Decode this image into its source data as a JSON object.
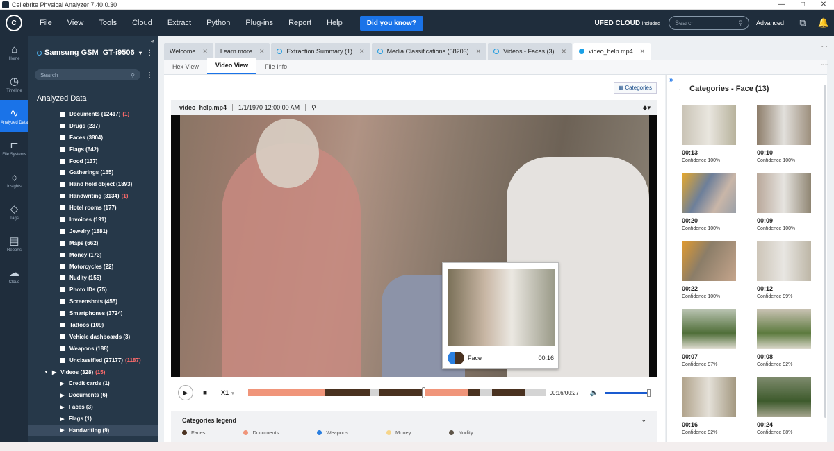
{
  "window": {
    "title": "Cellebrite Physical Analyzer 7.40.0.30",
    "min": "—",
    "max": "□",
    "close": "✕"
  },
  "menu": {
    "items": [
      "File",
      "View",
      "Tools",
      "Cloud",
      "Extract",
      "Python",
      "Plug-ins",
      "Report",
      "Help"
    ],
    "did_you_know": "Did you know?",
    "ufed_cloud": "UFED CLOUD",
    "ufed_included": "included",
    "search_placeholder": "Search",
    "advanced": "Advanced"
  },
  "rail": [
    {
      "label": "Home",
      "icon": "home-icon",
      "glyph": "⌂"
    },
    {
      "label": "Timeline",
      "icon": "clock-icon",
      "glyph": "◷"
    },
    {
      "label": "Analyzed Data",
      "icon": "pulse-icon",
      "glyph": "∿"
    },
    {
      "label": "File Systems",
      "icon": "folder-tree-icon",
      "glyph": "⊏"
    },
    {
      "label": "Insights",
      "icon": "lightbulb-icon",
      "glyph": "☼"
    },
    {
      "label": "Tags",
      "icon": "tag-icon",
      "glyph": "◇"
    },
    {
      "label": "Reports",
      "icon": "report-icon",
      "glyph": "▤"
    },
    {
      "label": "Cloud",
      "icon": "cloud-icon",
      "glyph": "☁"
    }
  ],
  "tree": {
    "device": "Samsung GSM_GT-i9506 Ga...",
    "search_placeholder": "Search",
    "title": "Analyzed Data",
    "items": [
      {
        "label": "Documents (12417)",
        "red": "(1)"
      },
      {
        "label": "Drugs (237)",
        "red": ""
      },
      {
        "label": "Faces (3804)",
        "red": ""
      },
      {
        "label": "Flags (642)",
        "red": ""
      },
      {
        "label": "Food (137)",
        "red": ""
      },
      {
        "label": "Gatherings (165)",
        "red": ""
      },
      {
        "label": "Hand hold object (1893)",
        "red": ""
      },
      {
        "label": "Handwriting (3134)",
        "red": "(1)"
      },
      {
        "label": "Hotel rooms (177)",
        "red": ""
      },
      {
        "label": "Invoices (191)",
        "red": ""
      },
      {
        "label": "Jewelry (1881)",
        "red": ""
      },
      {
        "label": "Maps (662)",
        "red": ""
      },
      {
        "label": "Money (173)",
        "red": ""
      },
      {
        "label": "Motorcycles (22)",
        "red": ""
      },
      {
        "label": "Nudity (155)",
        "red": ""
      },
      {
        "label": "Photo IDs (75)",
        "red": ""
      },
      {
        "label": "Screenshots (455)",
        "red": ""
      },
      {
        "label": "Smartphones (3724)",
        "red": ""
      },
      {
        "label": "Tattoos (109)",
        "red": ""
      },
      {
        "label": "Vehicle dashboards (3)",
        "red": ""
      },
      {
        "label": "Weapons (188)",
        "red": ""
      },
      {
        "label": "Unclassified (27177)",
        "red": "(1187)"
      }
    ],
    "videos": {
      "label": "Videos (328)",
      "red": "(15)"
    },
    "video_children": [
      {
        "label": "Credit cards (1)"
      },
      {
        "label": "Documents (6)"
      },
      {
        "label": "Faces (3)"
      },
      {
        "label": "Flags (1)"
      },
      {
        "label": "Handwriting (9)"
      }
    ]
  },
  "tabs": [
    {
      "label": "Welcome",
      "ring": "none"
    },
    {
      "label": "Learn more",
      "ring": "none"
    },
    {
      "label": "Extraction Summary (1)",
      "ring": "outline"
    },
    {
      "label": "Media Classifications (58203)",
      "ring": "outline"
    },
    {
      "label": "Videos - Faces (3)",
      "ring": "outline"
    },
    {
      "label": "video_help.mp4",
      "ring": "filled"
    }
  ],
  "subtabs": [
    "Hex View",
    "Video View",
    "File Info"
  ],
  "viewer": {
    "categories_btn": "Categories",
    "file_name": "video_help.mp4",
    "file_date": "1/1/1970 12:00:00 AM",
    "popup_label": "Face",
    "popup_time": "00:16",
    "speed": "X1",
    "timecode": "00:16/00:27",
    "progress": 0.59
  },
  "legend": {
    "title": "Categories legend",
    "items": [
      {
        "label": "Faces",
        "color": "#4a3220"
      },
      {
        "label": "Documents",
        "color": "#f0957a"
      },
      {
        "label": "Weapons",
        "color": "#2a7fe0"
      },
      {
        "label": "Money",
        "color": "#f6d58a"
      },
      {
        "label": "Nudity",
        "color": "#5e5548"
      }
    ]
  },
  "faces_panel": {
    "title": "Categories - Face (13)",
    "items": [
      {
        "time": "00:13",
        "conf": "Confidence 100%"
      },
      {
        "time": "00:10",
        "conf": "Confidence 100%"
      },
      {
        "time": "00:20",
        "conf": "Confidence 100%"
      },
      {
        "time": "00:09",
        "conf": "Confidence 100%"
      },
      {
        "time": "00:22",
        "conf": "Confidence 100%"
      },
      {
        "time": "00:12",
        "conf": "Confidence 99%"
      },
      {
        "time": "00:07",
        "conf": "Confidence 97%"
      },
      {
        "time": "00:08",
        "conf": "Confidence 92%"
      },
      {
        "time": "00:16",
        "conf": "Confidence 92%"
      },
      {
        "time": "00:24",
        "conf": "Confidence 88%"
      }
    ]
  }
}
